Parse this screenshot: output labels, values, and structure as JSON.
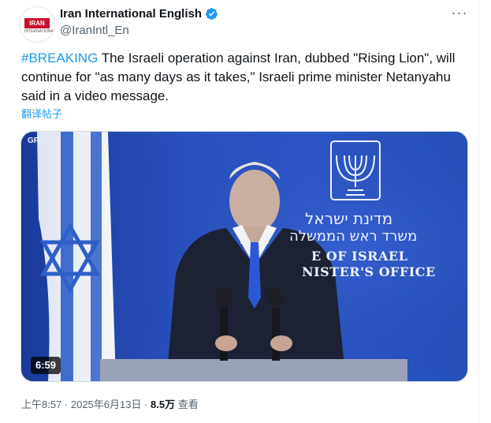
{
  "author": {
    "display_name": "Iran International English",
    "handle": "@IranIntl_En",
    "avatar_label": "IRAN",
    "avatar_sub": "INTERNATIONAL"
  },
  "tweet": {
    "hashtag": "#BREAKING",
    "body": " The Israeli operation against Iran, dubbed \"Rising Lion\", will continue for \"as many days as it takes,\" Israeli prime minister Netanyahu said in a video message.",
    "translate_label": "翻译帖子"
  },
  "media": {
    "duration": "6:59",
    "watermark": "GPO",
    "sign_he_line1": "מדינת ישראל",
    "sign_he_line2": "משרד ראש הממשלה",
    "sign_en_line1": "E OF ISRAEL",
    "sign_en_line2": "NISTER'S OFFICE"
  },
  "meta": {
    "time": "上午8:57 · 2025年6月13日 · ",
    "views_count": "8.5万",
    "views_label": " 查看"
  },
  "colors": {
    "accent": "#1d9bf0",
    "secondary_text": "#536471",
    "primary_text": "#0f1419"
  }
}
